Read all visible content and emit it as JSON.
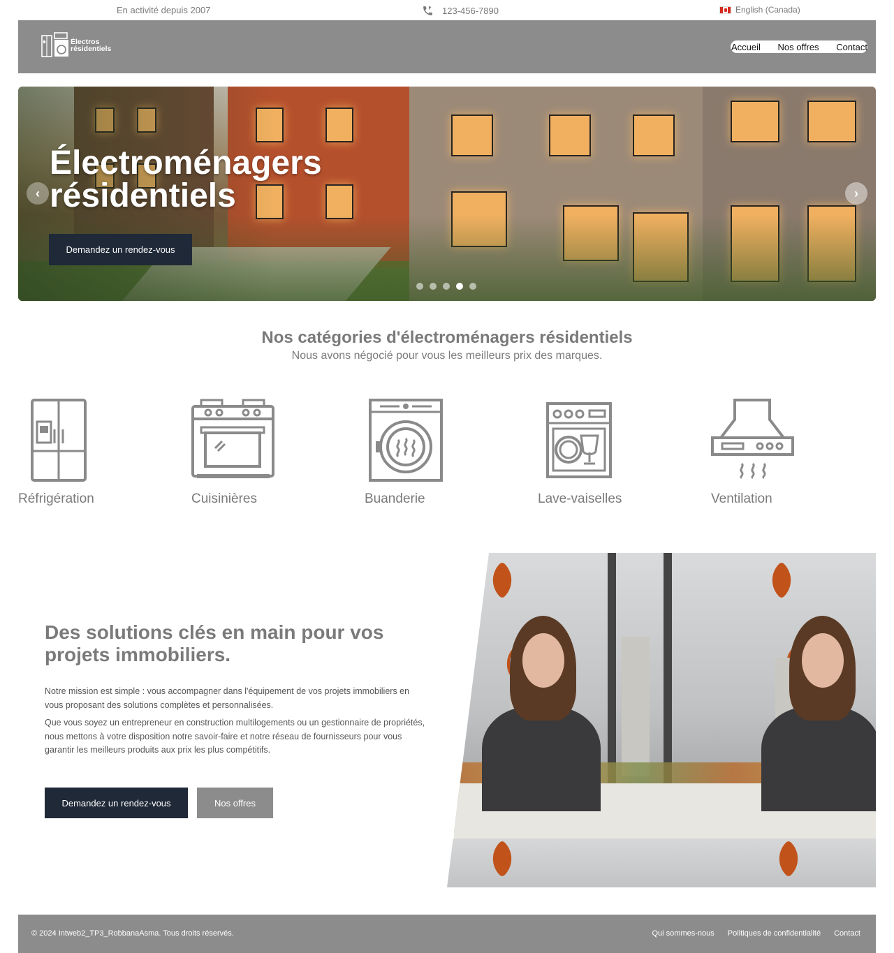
{
  "topbar": {
    "since": "En activité depuis 2007",
    "phone": "123-456-7890",
    "language": "English (Canada)"
  },
  "header": {
    "logo_line1": "Électros",
    "logo_line2": "résidentiels",
    "nav": [
      "Accueil",
      "Nos offres",
      "Contact"
    ]
  },
  "hero": {
    "title_line1": "Électroménagers",
    "title_line2": "résidentiels",
    "cta": "Demandez un rendez-vous",
    "slide_count": 5,
    "active_slide": 4
  },
  "categories": {
    "title": "Nos catégories d'électroménagers résidentiels",
    "subtitle": "Nous avons négocié pour vous les meilleurs prix des marques.",
    "items": [
      {
        "label": "Réfrigération",
        "icon": "refrigerator-icon"
      },
      {
        "label": "Cuisinières",
        "icon": "stove-icon"
      },
      {
        "label": "Buanderie",
        "icon": "washing-machine-icon"
      },
      {
        "label": "Lave-vaiselles",
        "icon": "dishwasher-icon"
      },
      {
        "label": "Ventilation",
        "icon": "range-hood-icon"
      }
    ]
  },
  "solutions": {
    "title_part1": "Des solutions",
    "title_part2": " clés en main ",
    "title_part3": "pour vos projets immobiliers.",
    "p1": "Notre mission est simple : vous accompagner dans l'équipement de vos projets immobiliers en vous proposant des solutions complètes et personnalisées.",
    "p2": "Que vous soyez un entrepreneur en construction multilogements ou un gestionnaire de propriétés, nous mettons à votre disposition notre savoir-faire et notre réseau de fournisseurs pour vous garantir les meilleurs produits aux prix les plus compétitifs.",
    "btn_primary": "Demandez un rendez-vous",
    "btn_secondary": "Nos offres"
  },
  "footer": {
    "copyright": "© 2024 Intweb2_TP3_RobbanaAsma. Tous droits réservés.",
    "links": [
      "Qui sommes-nous",
      "Politiques de confidentialité",
      "Contact"
    ]
  },
  "colors": {
    "header_bg": "#8c8c8c",
    "dark_button": "#1f2937",
    "text_gray": "#7a7a7a"
  }
}
